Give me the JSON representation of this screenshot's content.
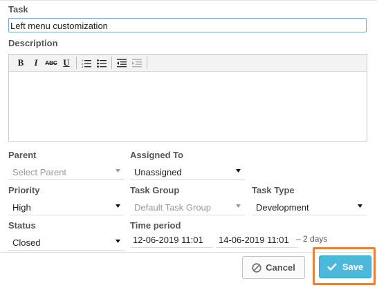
{
  "task": {
    "label": "Task",
    "value": "Left menu customization"
  },
  "description": {
    "label": "Description",
    "toolbar": {
      "bold": "B",
      "italic": "I",
      "strike": "ABC",
      "underline": "U",
      "icons": [
        "bold-icon",
        "italic-icon",
        "strikethrough-icon",
        "underline-icon",
        "ordered-list-icon",
        "unordered-list-icon",
        "outdent-icon",
        "indent-icon"
      ]
    }
  },
  "parent": {
    "label": "Parent",
    "value": "Select Parent"
  },
  "assigned_to": {
    "label": "Assigned To",
    "value": "Unassigned"
  },
  "priority": {
    "label": "Priority",
    "value": "High"
  },
  "task_group": {
    "label": "Task Group",
    "value": "Default Task Group"
  },
  "task_type": {
    "label": "Task Type",
    "value": "Development"
  },
  "status": {
    "label": "Status",
    "value": "Closed"
  },
  "time_period": {
    "label": "Time period",
    "start": "12-06-2019 11:01",
    "end": "14-06-2019 11:01",
    "duration": "– 2 days"
  },
  "buttons": {
    "cancel": "Cancel",
    "save": "Save"
  },
  "colors": {
    "save_bg": "#4db8db",
    "highlight": "#e8803d",
    "field_focus": "#7aa7d6"
  }
}
